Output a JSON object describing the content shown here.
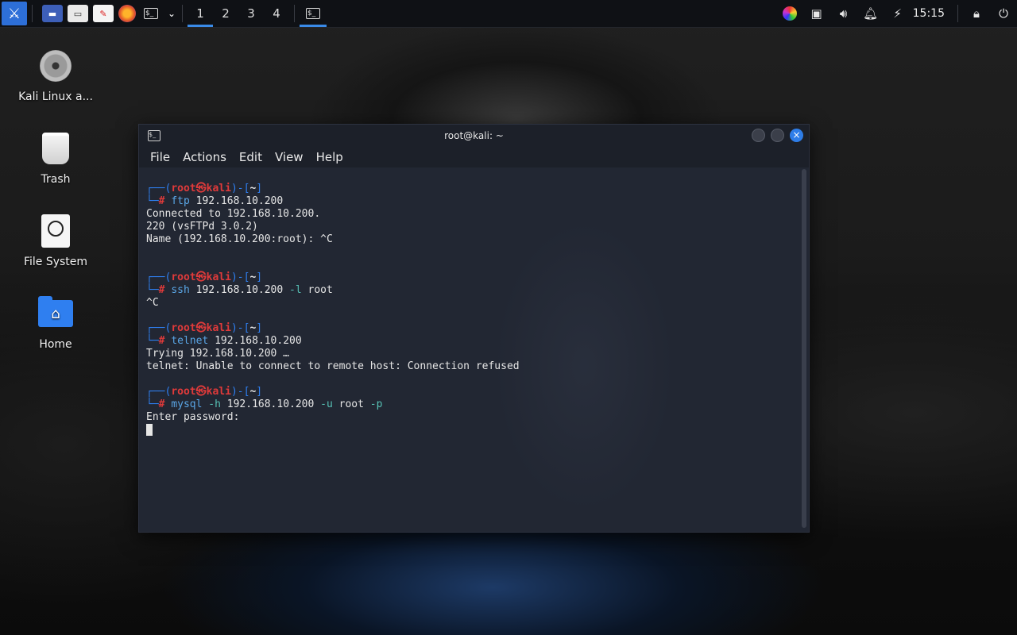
{
  "panel": {
    "workspaces": [
      "1",
      "2",
      "3",
      "4"
    ],
    "active_workspace": 0,
    "clock": "15:15"
  },
  "desktop_icons": [
    {
      "label": "Kali Linux a..."
    },
    {
      "label": "Trash"
    },
    {
      "label": "File System"
    },
    {
      "label": "Home"
    }
  ],
  "window": {
    "title": "root@kali: ~",
    "menu": [
      "File",
      "Actions",
      "Edit",
      "View",
      "Help"
    ]
  },
  "terminal": {
    "prompt_user": "root",
    "prompt_sep": "㉿",
    "prompt_host": "kali",
    "prompt_dir": "~",
    "blocks": [
      {
        "cmd": "ftp",
        "args": " 192.168.10.200",
        "output": [
          "Connected to 192.168.10.200.",
          "220 (vsFTPd 3.0.2)",
          "Name (192.168.10.200:root): ^C"
        ]
      },
      {
        "cmd": "ssh",
        "args": " 192.168.10.200 ",
        "opt1": "-l",
        "args2": " root",
        "output": [
          "^C"
        ]
      },
      {
        "cmd": "telnet",
        "args": " 192.168.10.200",
        "output": [
          "Trying 192.168.10.200 …",
          "telnet: Unable to connect to remote host: Connection refused"
        ]
      },
      {
        "cmd": "mysql",
        "opt_h": " -h",
        "args": " 192.168.10.200 ",
        "opt_u": "-u",
        "args2": " root ",
        "opt_p": "-p",
        "output": [
          "Enter password:"
        ]
      }
    ]
  },
  "colors": {
    "accent": "#2f7ff0",
    "prompt_user": "#e03a3a",
    "terminal_bg": "#222733"
  }
}
